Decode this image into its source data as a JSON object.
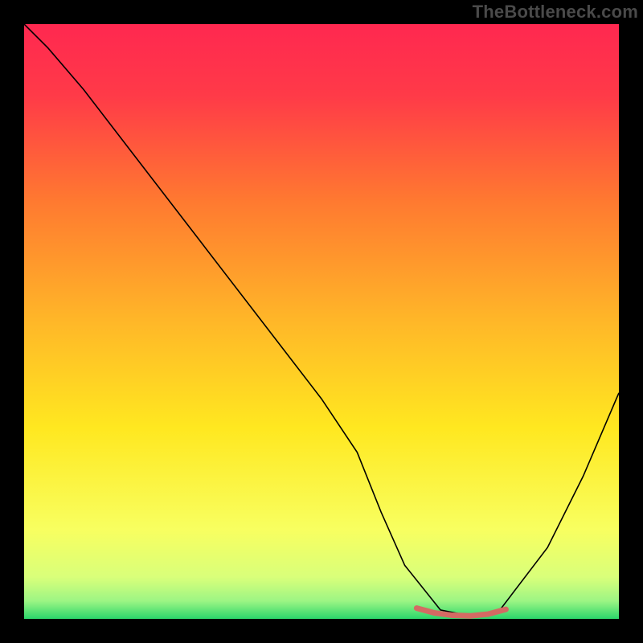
{
  "attribution": "TheBottleneck.com",
  "chart_data": {
    "type": "line",
    "title": "",
    "xlabel": "",
    "ylabel": "",
    "xlim": [
      0,
      100
    ],
    "ylim": [
      0,
      100
    ],
    "background_gradient": {
      "top": "#ff2850",
      "mid1": "#ff8a2c",
      "mid2": "#ffe820",
      "mid3": "#faff7a",
      "bottom": "#2bd66b"
    },
    "series": [
      {
        "name": "bottleneck-curve",
        "color": "#000000",
        "stroke_width": 1.6,
        "x": [
          0,
          4,
          10,
          20,
          30,
          40,
          50,
          56,
          60,
          64,
          70,
          75,
          80,
          88,
          94,
          100
        ],
        "y": [
          100,
          96,
          89,
          76,
          63,
          50,
          37,
          28,
          18,
          9,
          1.5,
          0.5,
          1.5,
          12,
          24,
          38
        ]
      },
      {
        "name": "highlight-segment",
        "color": "#d46a63",
        "stroke_width": 7,
        "linecap": "round",
        "x": [
          66,
          69,
          72,
          75,
          78,
          81
        ],
        "y": [
          1.8,
          1.0,
          0.6,
          0.5,
          0.8,
          1.6
        ]
      }
    ]
  }
}
